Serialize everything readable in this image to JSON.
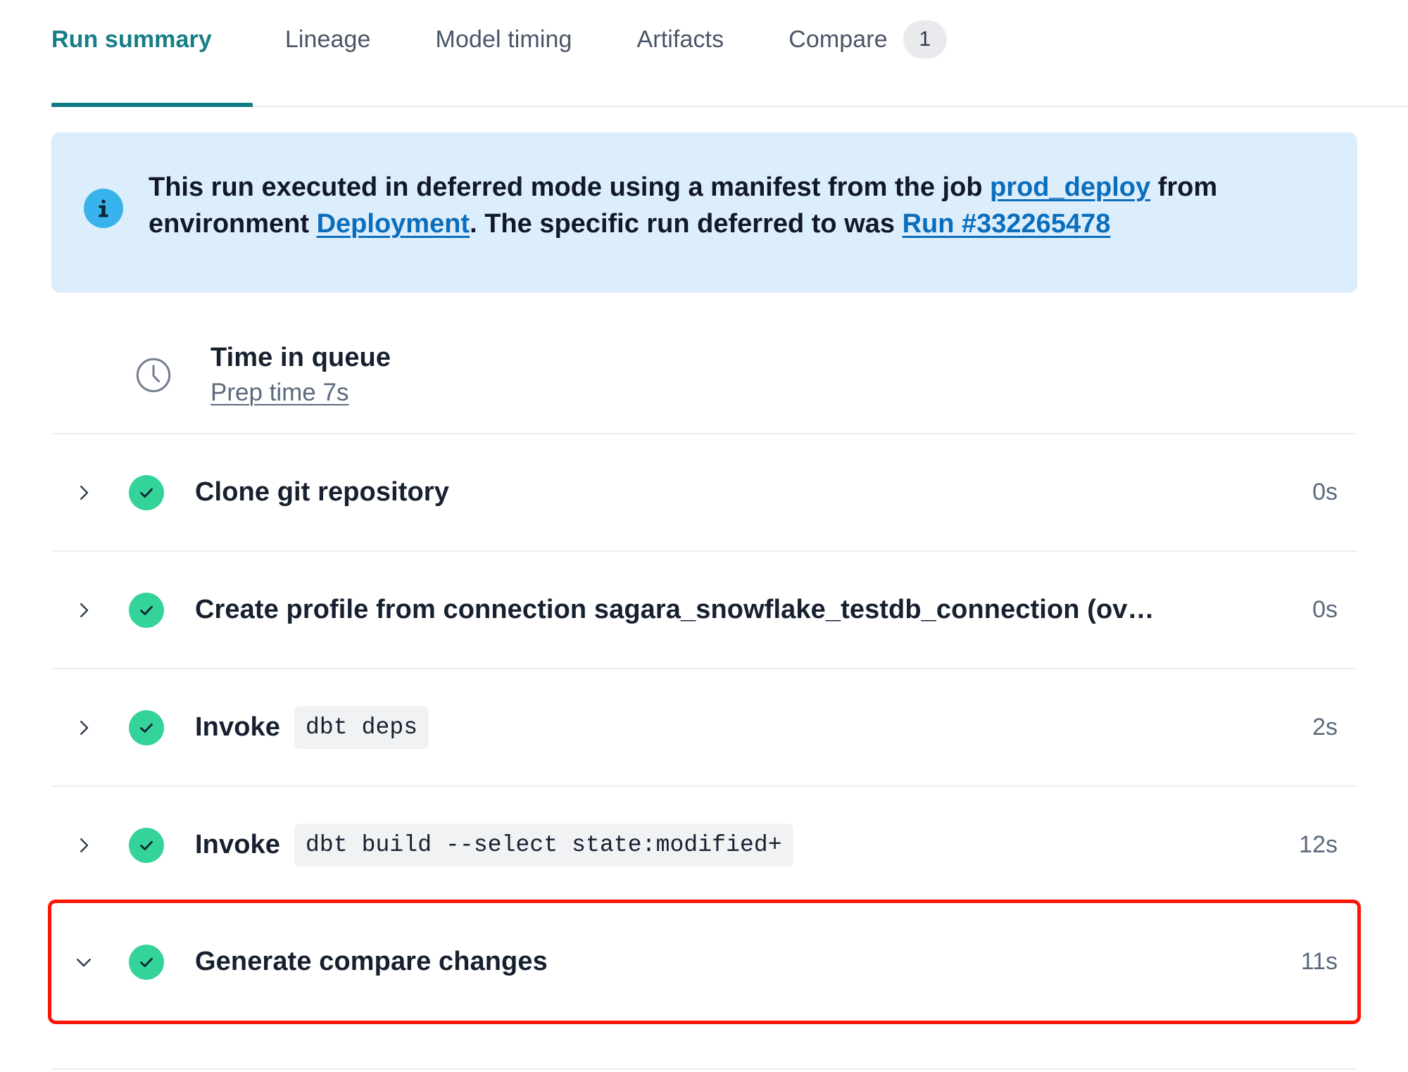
{
  "tabs": [
    {
      "label": "Run summary",
      "active": true,
      "badge": null
    },
    {
      "label": "Lineage",
      "active": false,
      "badge": null
    },
    {
      "label": "Model timing",
      "active": false,
      "badge": null
    },
    {
      "label": "Artifacts",
      "active": false,
      "badge": null
    },
    {
      "label": "Compare",
      "active": false,
      "badge": "1"
    }
  ],
  "banner": {
    "icon": "info-icon",
    "text_part1": "This run executed in deferred mode using a manifest from the job ",
    "link_job": "prod_deploy",
    "text_part2": " from environment ",
    "link_environment": "Deployment",
    "text_part3": ". The specific run deferred to was ",
    "link_run": "Run #332265478",
    "background_color": "#dcedfb",
    "icon_color": "#39b3ec",
    "link_color": "#0a6ebd"
  },
  "queue": {
    "icon": "clock-icon",
    "title": "Time in queue",
    "subtitle": "Prep time 7s"
  },
  "steps": [
    {
      "chevron": "chevron-right-icon",
      "status": "success-check-icon",
      "label": "Clone git repository",
      "code": null,
      "duration": "0s",
      "highlighted": false
    },
    {
      "chevron": "chevron-right-icon",
      "status": "success-check-icon",
      "label": "Create profile from connection sagara_snowflake_testdb_connection (ov…",
      "code": null,
      "duration": "0s",
      "highlighted": false
    },
    {
      "chevron": "chevron-right-icon",
      "status": "success-check-icon",
      "label": "Invoke",
      "code": "dbt deps",
      "duration": "2s",
      "highlighted": false
    },
    {
      "chevron": "chevron-right-icon",
      "status": "success-check-icon",
      "label": "Invoke",
      "code": "dbt build --select state:modified+",
      "duration": "12s",
      "highlighted": false
    },
    {
      "chevron": "chevron-down-icon",
      "status": "success-check-icon",
      "label": "Generate compare changes",
      "code": null,
      "duration": "11s",
      "highlighted": true
    }
  ],
  "colors": {
    "accent_teal": "#0f7a84",
    "success_green": "#34d399",
    "highlight_red": "#fc1505",
    "text_dark": "#16202f",
    "text_muted": "#5c6a7d"
  }
}
